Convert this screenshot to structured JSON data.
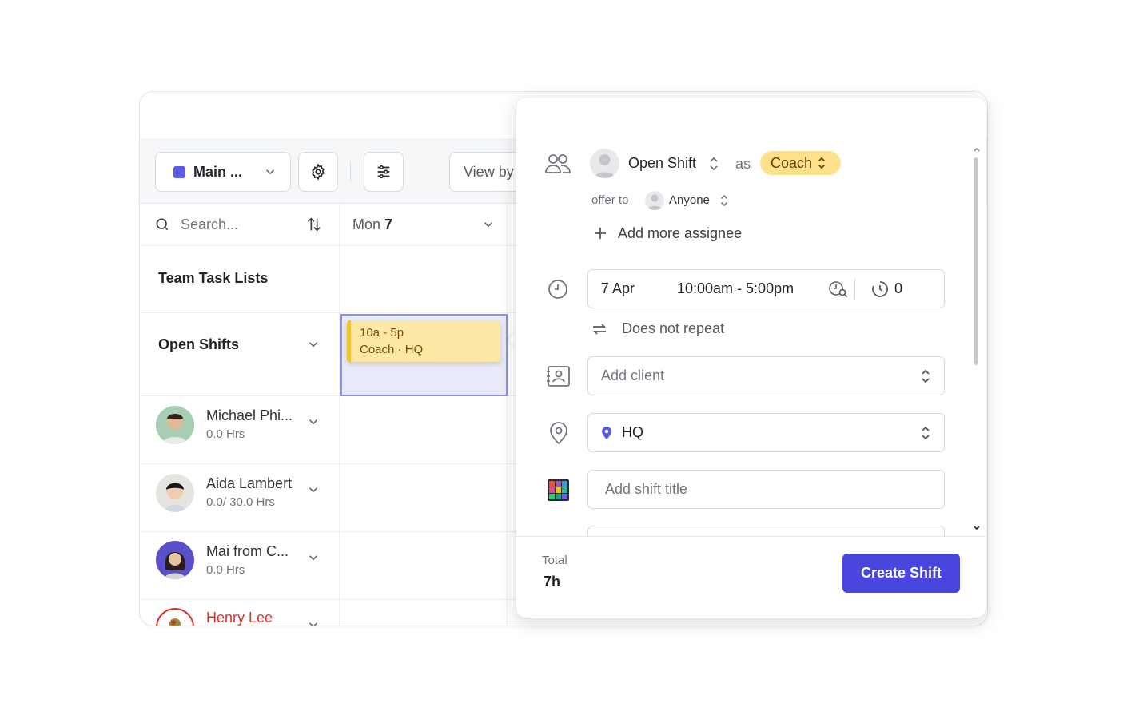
{
  "toolbar": {
    "location_label": "Main ...",
    "location_color": "#5b5ce2",
    "view_by_label": "View by"
  },
  "grid": {
    "search_placeholder": "Search...",
    "day_label": "Mon",
    "day_number": "7",
    "team_task_lists": "Team Task Lists",
    "open_shifts": "Open Shifts",
    "people": [
      {
        "name": "Michael Phi...",
        "hours": "0.0 Hrs"
      },
      {
        "name": "Aida Lambert",
        "hours": "0.0/ 30.0 Hrs"
      },
      {
        "name": "Mai from C...",
        "hours": "0.0 Hrs"
      },
      {
        "name": "Henry Lee",
        "hours": ""
      }
    ],
    "shift_card": {
      "time": "10a - 5p",
      "detail": "Coach · HQ",
      "color": "#fde8a5"
    }
  },
  "dialog": {
    "assignee": "Open Shift",
    "as_label": "as",
    "role": "Coach",
    "offer_to_label": "offer to",
    "offer_to_value": "Anyone",
    "add_assignee": "Add more assignee",
    "date": "7 Apr",
    "time_range": "10:00am -  5:00pm",
    "break_minutes": "0",
    "repeat": "Does not repeat",
    "client_placeholder": "Add client",
    "location": "HQ",
    "shift_title_placeholder": "Add shift title",
    "total_label": "Total",
    "total_value": "7h",
    "create_label": "Create Shift",
    "accent_color": "#4b45e0"
  }
}
